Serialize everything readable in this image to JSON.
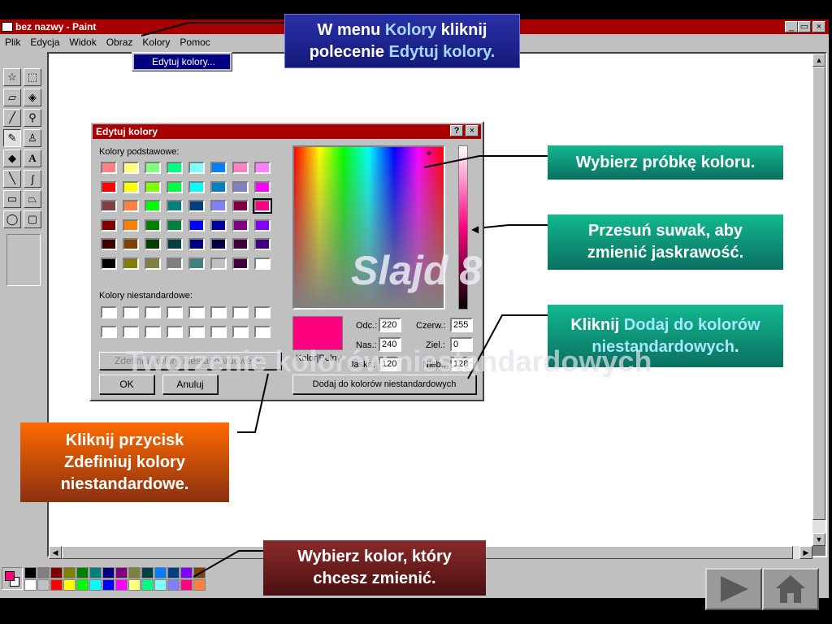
{
  "window": {
    "title": "bez nazwy - Paint",
    "controls": [
      "_",
      "▭",
      "×"
    ]
  },
  "menu": [
    "Plik",
    "Edycja",
    "Widok",
    "Obraz",
    "Kolory",
    "Pomoc"
  ],
  "dropdown": {
    "item": "Edytuj kolory..."
  },
  "dialog": {
    "title": "Edytuj kolory",
    "help": "?",
    "close": "×",
    "basic_label": "Kolory podstawowe:",
    "custom_label": "Kolory niestandardowe:",
    "basic_colors": [
      "#ff8080",
      "#ffff80",
      "#80ff80",
      "#00ff80",
      "#80ffff",
      "#0080ff",
      "#ff80c0",
      "#ff80ff",
      "#ff0000",
      "#ffff00",
      "#80ff00",
      "#00ff40",
      "#00ffff",
      "#0080c0",
      "#8080c0",
      "#ff00ff",
      "#804040",
      "#ff8040",
      "#00ff00",
      "#008080",
      "#004080",
      "#8080ff",
      "#800040",
      "#ff0080",
      "#800000",
      "#ff8000",
      "#008000",
      "#008040",
      "#0000ff",
      "#0000a0",
      "#800080",
      "#8000ff",
      "#400000",
      "#804000",
      "#004000",
      "#004040",
      "#000080",
      "#000040",
      "#400040",
      "#400080",
      "#000000",
      "#808000",
      "#808040",
      "#808080",
      "#408080",
      "#c0c0c0",
      "#400040",
      "#ffffff"
    ],
    "define_button": "Zdefiniuj kolory niestandardowe >>",
    "ok_button": "OK",
    "cancel_button": "Anuluj",
    "color_solid_label": "Kolor|Pełny",
    "fields": {
      "hue_label": "Odc.:",
      "hue": "220",
      "sat_label": "Nas.:",
      "sat": "240",
      "lum_label": "Jaskr.:",
      "lum": "120",
      "red_label": "Czerw.:",
      "red": "255",
      "green_label": "Ziel.:",
      "green": "0",
      "blue_label": "Nieb.:",
      "blue": "128"
    },
    "add_button": "Dodaj do kolorów niestandardowych",
    "selected_color": "#ff0080"
  },
  "palette": {
    "row1": [
      "#000000",
      "#808080",
      "#800000",
      "#808000",
      "#008000",
      "#008080",
      "#000080",
      "#800080",
      "#808040",
      "#004040",
      "#0080ff",
      "#004080",
      "#8000ff",
      "#804000"
    ],
    "row2": [
      "#ffffff",
      "#c0c0c0",
      "#ff0000",
      "#ffff00",
      "#00ff00",
      "#00ffff",
      "#0000ff",
      "#ff00ff",
      "#ffff80",
      "#00ff80",
      "#80ffff",
      "#8080ff",
      "#ff0080",
      "#ff8040"
    ],
    "fg": "#ff0080",
    "bg": "#ffffff"
  },
  "callouts": {
    "menu_a": "W menu ",
    "menu_b": "Kolory",
    "menu_c": " kliknij",
    "menu_d": "polecenie ",
    "menu_e": "Edytuj kolory.",
    "sample": "Wybierz próbkę koloru.",
    "slider": "Przesuń suwak, aby zmienić jaskrawość.",
    "add_a": "Kliknij ",
    "add_b": "Dodaj do kolorów niestandardowych",
    "add_c": ".",
    "define": "Kliknij przycisk Zdefiniuj kolory niestandardowe.",
    "pick": "Wybierz kolor, który chcesz zmienić."
  },
  "overlay": {
    "slide": "Slajd 8",
    "heading": "Tworzenie kolorów niestandardowych"
  }
}
